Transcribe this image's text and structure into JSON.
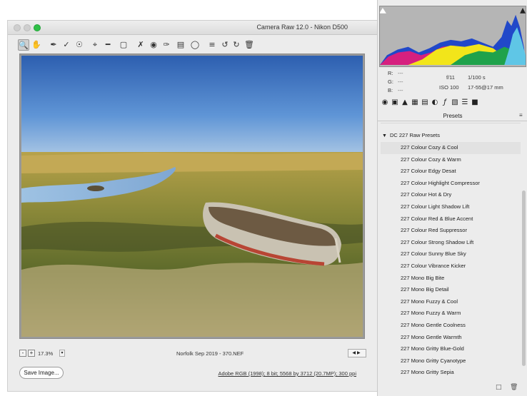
{
  "window": {
    "title": "Camera Raw 12.0  -  Nikon D500"
  },
  "toolbar": {
    "tools": [
      "zoom-tool",
      "hand-tool",
      "white-balance-tool",
      "color-sampler-tool",
      "targeted-adjustment-tool",
      "crop-tool",
      "straighten-tool",
      "transform-tool",
      "spot-removal-tool",
      "red-eye-tool",
      "adjustment-brush-tool",
      "graduated-filter-tool",
      "radial-filter-tool",
      "preferences",
      "rotate-left",
      "rotate-right",
      "trash"
    ]
  },
  "status": {
    "zoom": "17.3%",
    "filename": "Norfolk Sep 2019 - 370.NEF"
  },
  "bottom": {
    "save_label": "Save Image...",
    "workflow": "Adobe RGB (1998); 8 bit; 5568 by 3712 (20.7MP); 300 ppi"
  },
  "readout": {
    "r_label": "R:",
    "g_label": "G:",
    "b_label": "B:",
    "r": "---",
    "g": "---",
    "b": "---",
    "aperture": "f/11",
    "shutter": "1/100 s",
    "iso": "ISO 100",
    "lens": "17-55@17 mm"
  },
  "panel": {
    "title": "Presets",
    "group": "DC 227 Raw Presets",
    "presets": [
      "227 Colour Cozy & Cool",
      "227 Colour Cozy & Warm",
      "227 Colour Edgy Desat",
      "227 Colour Highlight Compressor",
      "227 Colour Hot & Dry",
      "227 Colour Light Shadow Lift",
      "227 Colour Red & Blue Accent",
      "227 Colour Red Suppressor",
      "227 Colour Strong Shadow Lift",
      "227 Colour Sunny Blue Sky",
      "227 Colour Vibrance Kicker",
      "227 Mono Big Bite",
      "227 Mono Big Detail",
      "227 Mono Fuzzy & Cool",
      "227 Mono Fuzzy & Warm",
      "227 Mono Gentle Coolness",
      "227 Mono Gentle Warmth",
      "227 Mono Gritty Blue-Gold",
      "227 Mono Gritty Cyanotype",
      "227 Mono Gritty Sepia"
    ]
  },
  "colors": {
    "traffic_zoom": "#2fc047",
    "histogram_bg": "#b5b5b5"
  }
}
